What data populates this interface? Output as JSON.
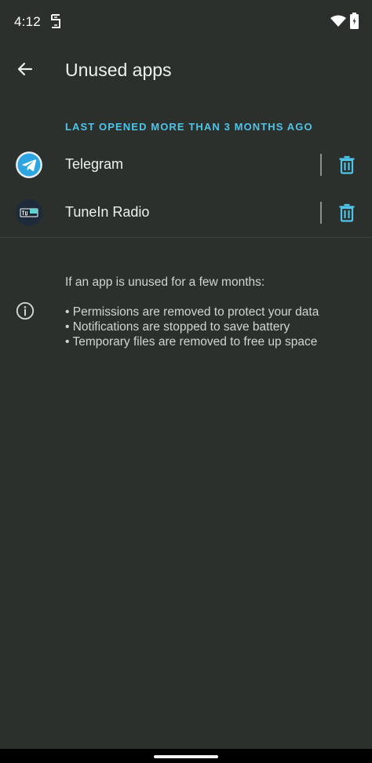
{
  "status_bar": {
    "time": "4:12"
  },
  "app_bar": {
    "title": "Unused apps"
  },
  "section": {
    "header": "LAST OPENED MORE THAN 3 MONTHS AGO"
  },
  "apps": [
    {
      "name": "Telegram",
      "icon": "telegram-icon",
      "color": "#2ca5e0"
    },
    {
      "name": "TuneIn Radio",
      "icon": "tunein-icon",
      "color": "#1c2a3a"
    }
  ],
  "info": {
    "heading": "If an app is unused for a few months:",
    "bullets": [
      "• Permissions are removed to protect your data",
      "• Notifications are stopped to save battery",
      "• Temporary files are removed to free up space"
    ]
  },
  "colors": {
    "background": "#2b302d",
    "accent": "#4fc3e8",
    "text_primary": "#eef2ef",
    "text_secondary": "#cfd5d1"
  }
}
